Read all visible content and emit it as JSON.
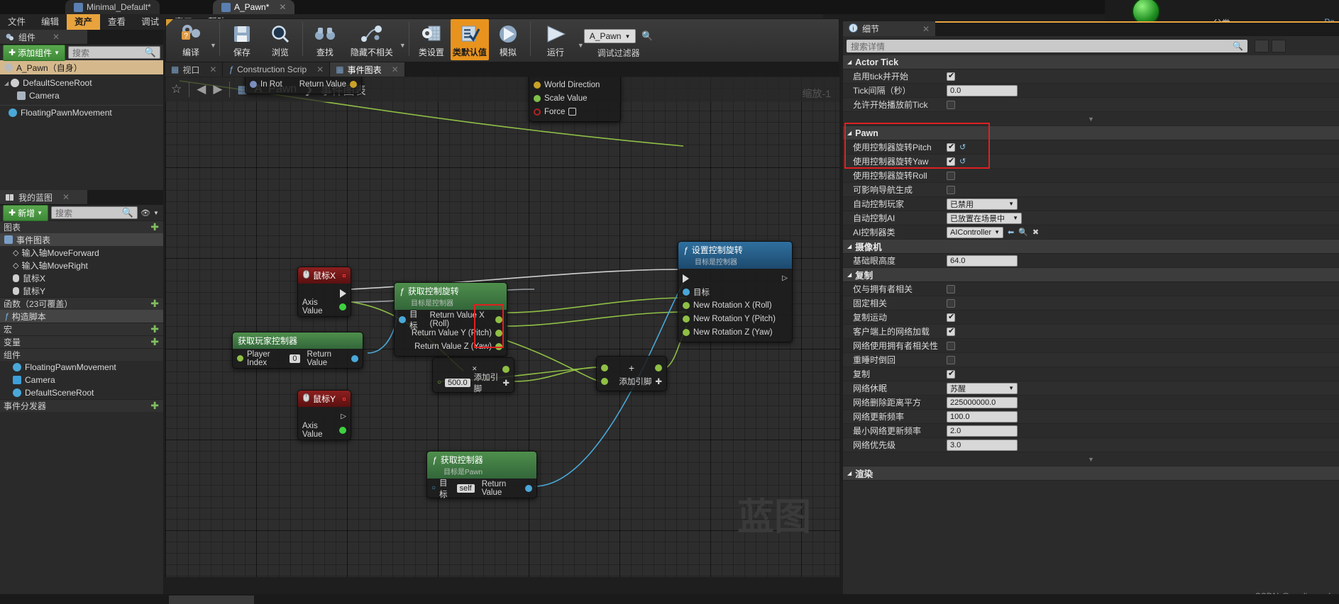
{
  "window": {
    "tabs": [
      {
        "label": "Minimal_Default*",
        "active": false
      },
      {
        "label": "A_Pawn*",
        "active": true,
        "close": "✕"
      }
    ]
  },
  "menu": {
    "items": [
      {
        "label": "文件",
        "selected": false
      },
      {
        "label": "编辑",
        "selected": false
      },
      {
        "label": "资产",
        "selected": true
      },
      {
        "label": "查看",
        "selected": false
      },
      {
        "label": "调试",
        "selected": false
      },
      {
        "label": "窗口",
        "selected": false
      },
      {
        "label": "帮助",
        "selected": false
      }
    ]
  },
  "topright": {
    "class_label": "父类:",
    "pa_link": "Pa"
  },
  "components_panel": {
    "title": "组件",
    "close": "✕",
    "add_button": "添加组件",
    "add_caret": "▼",
    "search_placeholder": "搜索",
    "tree": [
      {
        "label": "A_Pawn（自身）",
        "selected": true,
        "indent": 0,
        "icon": "pawn-icon"
      },
      {
        "label": "DefaultSceneRoot",
        "selected": false,
        "indent": 0,
        "icon": "scene-root-icon",
        "expander": "◢"
      },
      {
        "label": "Camera",
        "selected": false,
        "indent": 1,
        "icon": "camera-icon"
      },
      {
        "label": "FloatingPawnMovement",
        "selected": false,
        "indent": 0,
        "icon": "movement-icon"
      }
    ]
  },
  "myblueprint_panel": {
    "title": "我的蓝图",
    "close": "✕",
    "add_button": "新增",
    "add_caret": "▼",
    "search_placeholder": "搜索",
    "eye_icon": "👁",
    "sections": [
      {
        "label": "图表",
        "plus": "✚"
      },
      {
        "label": "函数（23可覆盖）",
        "plus": "✚"
      },
      {
        "label": "宏",
        "plus": "✚"
      },
      {
        "label": "变量",
        "plus": "✚"
      },
      {
        "label": "组件",
        "plus": "✚"
      },
      {
        "label": "事件分发器",
        "plus": "✚"
      }
    ],
    "graph_items": [
      {
        "label": "事件图表",
        "icon": "graph-icon",
        "indent": 0
      },
      {
        "label": "输入轴MoveForward",
        "icon": "event-diamond-icon",
        "indent": 1
      },
      {
        "label": "输入轴MoveRight",
        "icon": "event-diamond-icon",
        "indent": 1
      },
      {
        "label": "鼠标X",
        "icon": "mouse-icon",
        "indent": 1
      },
      {
        "label": "鼠标Y",
        "icon": "mouse-icon",
        "indent": 1
      }
    ],
    "function_items": [
      {
        "label": "构造脚本",
        "icon": "function-icon"
      }
    ],
    "component_items": [
      {
        "label": "FloatingPawnMovement",
        "icon": "movement-icon"
      },
      {
        "label": "Camera",
        "icon": "camera-icon"
      },
      {
        "label": "DefaultSceneRoot",
        "icon": "scene-root-icon"
      }
    ]
  },
  "toolbar": {
    "buttons": [
      {
        "label": "编译",
        "icon": "compile-icon",
        "active": false,
        "caret": true
      },
      {
        "label": "保存",
        "icon": "save-icon",
        "active": false
      },
      {
        "label": "浏览",
        "icon": "browse-icon",
        "active": false
      },
      {
        "label": "查找",
        "icon": "find-icon",
        "active": false
      },
      {
        "label": "隐藏不相关",
        "icon": "hide-unrelated-icon",
        "active": false,
        "caret": true
      },
      {
        "label": "类设置",
        "icon": "class-settings-icon",
        "active": false
      },
      {
        "label": "类默认值",
        "icon": "class-defaults-icon",
        "active": true
      },
      {
        "label": "模拟",
        "icon": "simulate-icon",
        "active": false
      },
      {
        "label": "运行",
        "icon": "play-icon",
        "active": false,
        "caret": true
      }
    ],
    "debug_filter_value": "A_Pawn",
    "debug_filter_caret": "▼",
    "debug_filter_label": "调试过滤器",
    "debug_search_icon": "search-icon"
  },
  "graph_tabs": [
    {
      "label": "视口",
      "icon": "viewport-icon",
      "active": false,
      "close": "✕"
    },
    {
      "label": "Construction Scrip",
      "icon": "function-italic-icon",
      "active": false,
      "close": "✕"
    },
    {
      "label": "事件图表",
      "icon": "graph-icon",
      "active": true,
      "close": "✕"
    }
  ],
  "graph": {
    "breadcrumb_root": "A_Pawn",
    "breadcrumb_sep": "❯",
    "breadcrumb_leaf": "事件图表",
    "star_icon": "☆",
    "back_icon": "◀",
    "forward_icon": "▶",
    "zoom_label": "缩放-1",
    "watermark": "蓝图"
  },
  "nodes": {
    "addmovement": {
      "left_pins": [
        {
          "label": "In Rot",
          "color": "#7a8fc0"
        }
      ],
      "right_pins": [
        {
          "label": "Return Value",
          "color": "#c9a227"
        }
      ],
      "target_pins": [
        {
          "label": "World Direction",
          "color": "#c9a227"
        },
        {
          "label": "Scale Value",
          "color": "#7fc04a"
        },
        {
          "label": "Force",
          "color": "#b32222",
          "checkbox": true
        }
      ]
    },
    "mouse_x": {
      "title": "鼠标X",
      "icon": "mouse-icon",
      "exec_out": "",
      "axis_value": "Axis Value",
      "stop_icon": "■"
    },
    "mouse_y": {
      "title": "鼠标Y",
      "icon": "mouse-icon",
      "axis_value": "Axis Value",
      "stop_icon": "■"
    },
    "get_control_rotation": {
      "title": "获取控制旋转",
      "subtitle": "目标是控制器",
      "target_label": "目标",
      "outputs": [
        "Return Value X (Roll)",
        "Return Value Y (Pitch)",
        "Return Value Z (Yaw)"
      ],
      "out_short": [
        "X (Roll)",
        "Y (Pitch)",
        "Z (Yaw)"
      ]
    },
    "get_player_controller": {
      "title": "获取玩家控制器",
      "player_index_label": "Player Index",
      "player_index_value": "0",
      "return_label": "Return Value"
    },
    "get_controller": {
      "title": "获取控制器",
      "subtitle": "目标是Pawn",
      "target_label": "目标",
      "target_value": "self",
      "return_label": "Return Value"
    },
    "float_literal": {
      "value": "500.0",
      "add_pin_label": "添加引脚",
      "add_pin_icon": "✚",
      "remove_icon": "✕"
    },
    "add_node": {
      "symbol": "+",
      "add_pin_label": "添加引脚",
      "add_pin_icon": "✚"
    },
    "set_control_rotation": {
      "title": "设置控制旋转",
      "subtitle": "目标是控制器",
      "target_label": "目标",
      "inputs": [
        "New Rotation X (Roll)",
        "New Rotation Y (Pitch)",
        "New Rotation Z (Yaw)"
      ]
    }
  },
  "details": {
    "title": "细节",
    "close": "✕",
    "search_placeholder": "搜索详情",
    "categories": [
      {
        "name": "Actor Tick",
        "arrow": "◢",
        "highlighted": false,
        "props": [
          {
            "label": "启用tick并开始",
            "type": "checkbox",
            "checked": true
          },
          {
            "label": "Tick间隔（秒）",
            "type": "text",
            "value": "0.0"
          },
          {
            "label": "允许开始播放前Tick",
            "type": "checkbox",
            "checked": false
          }
        ]
      },
      {
        "name": "Pawn",
        "arrow": "◢",
        "highlighted": true,
        "props": [
          {
            "label": "使用控制器旋转Pitch",
            "type": "checkbox",
            "checked": true,
            "reset": true
          },
          {
            "label": "使用控制器旋转Yaw",
            "type": "checkbox",
            "checked": true,
            "reset": true
          },
          {
            "label": "使用控制器旋转Roll",
            "type": "checkbox",
            "checked": false
          },
          {
            "label": "可影响导航生成",
            "type": "checkbox",
            "checked": false
          },
          {
            "label": "自动控制玩家",
            "type": "dropdown",
            "value": "已禁用"
          },
          {
            "label": "自动控制AI",
            "type": "dropdown",
            "value": "已放置在场景中"
          },
          {
            "label": "AI控制器类",
            "type": "dropdown-extra",
            "value": "AIController"
          }
        ]
      },
      {
        "name": "摄像机",
        "arrow": "◢",
        "highlighted": false,
        "props": [
          {
            "label": "基础眼高度",
            "type": "text",
            "value": "64.0"
          }
        ]
      },
      {
        "name": "复制",
        "arrow": "◢",
        "highlighted": false,
        "props": [
          {
            "label": "仅与拥有者相关",
            "type": "checkbox",
            "checked": false
          },
          {
            "label": "固定相关",
            "type": "checkbox",
            "checked": false
          },
          {
            "label": "复制运动",
            "type": "checkbox",
            "checked": true
          },
          {
            "label": "客户端上的网络加载",
            "type": "checkbox",
            "checked": true
          },
          {
            "label": "网络使用拥有者相关性",
            "type": "checkbox",
            "checked": false
          },
          {
            "label": "重睡时倒回",
            "type": "checkbox",
            "checked": false
          },
          {
            "label": "复制",
            "type": "checkbox",
            "checked": true
          },
          {
            "label": "网络休眠",
            "type": "dropdown",
            "value": "苏醒"
          },
          {
            "label": "网络删除距离平方",
            "type": "text",
            "value": "225000000.0"
          },
          {
            "label": "网络更新频率",
            "type": "text",
            "value": "100.0"
          },
          {
            "label": "最小网络更新频率",
            "type": "text",
            "value": "2.0"
          },
          {
            "label": "网络优先级",
            "type": "text",
            "value": "3.0"
          }
        ]
      },
      {
        "name": "渲染",
        "arrow": "◢",
        "highlighted": false,
        "props": []
      }
    ]
  },
  "credit": "CSDN @ye_liu_arch",
  "colors": {
    "accent_orange": "#e8931e",
    "selection_tan": "#d5b98d",
    "green_button": "#5aa84f",
    "red_highlight": "#e02020",
    "exec_white": "#dcdcdc",
    "float_green": "#7fc04a",
    "rotator_blue": "#7a8fc0",
    "object_blue": "#4aa8d8"
  }
}
